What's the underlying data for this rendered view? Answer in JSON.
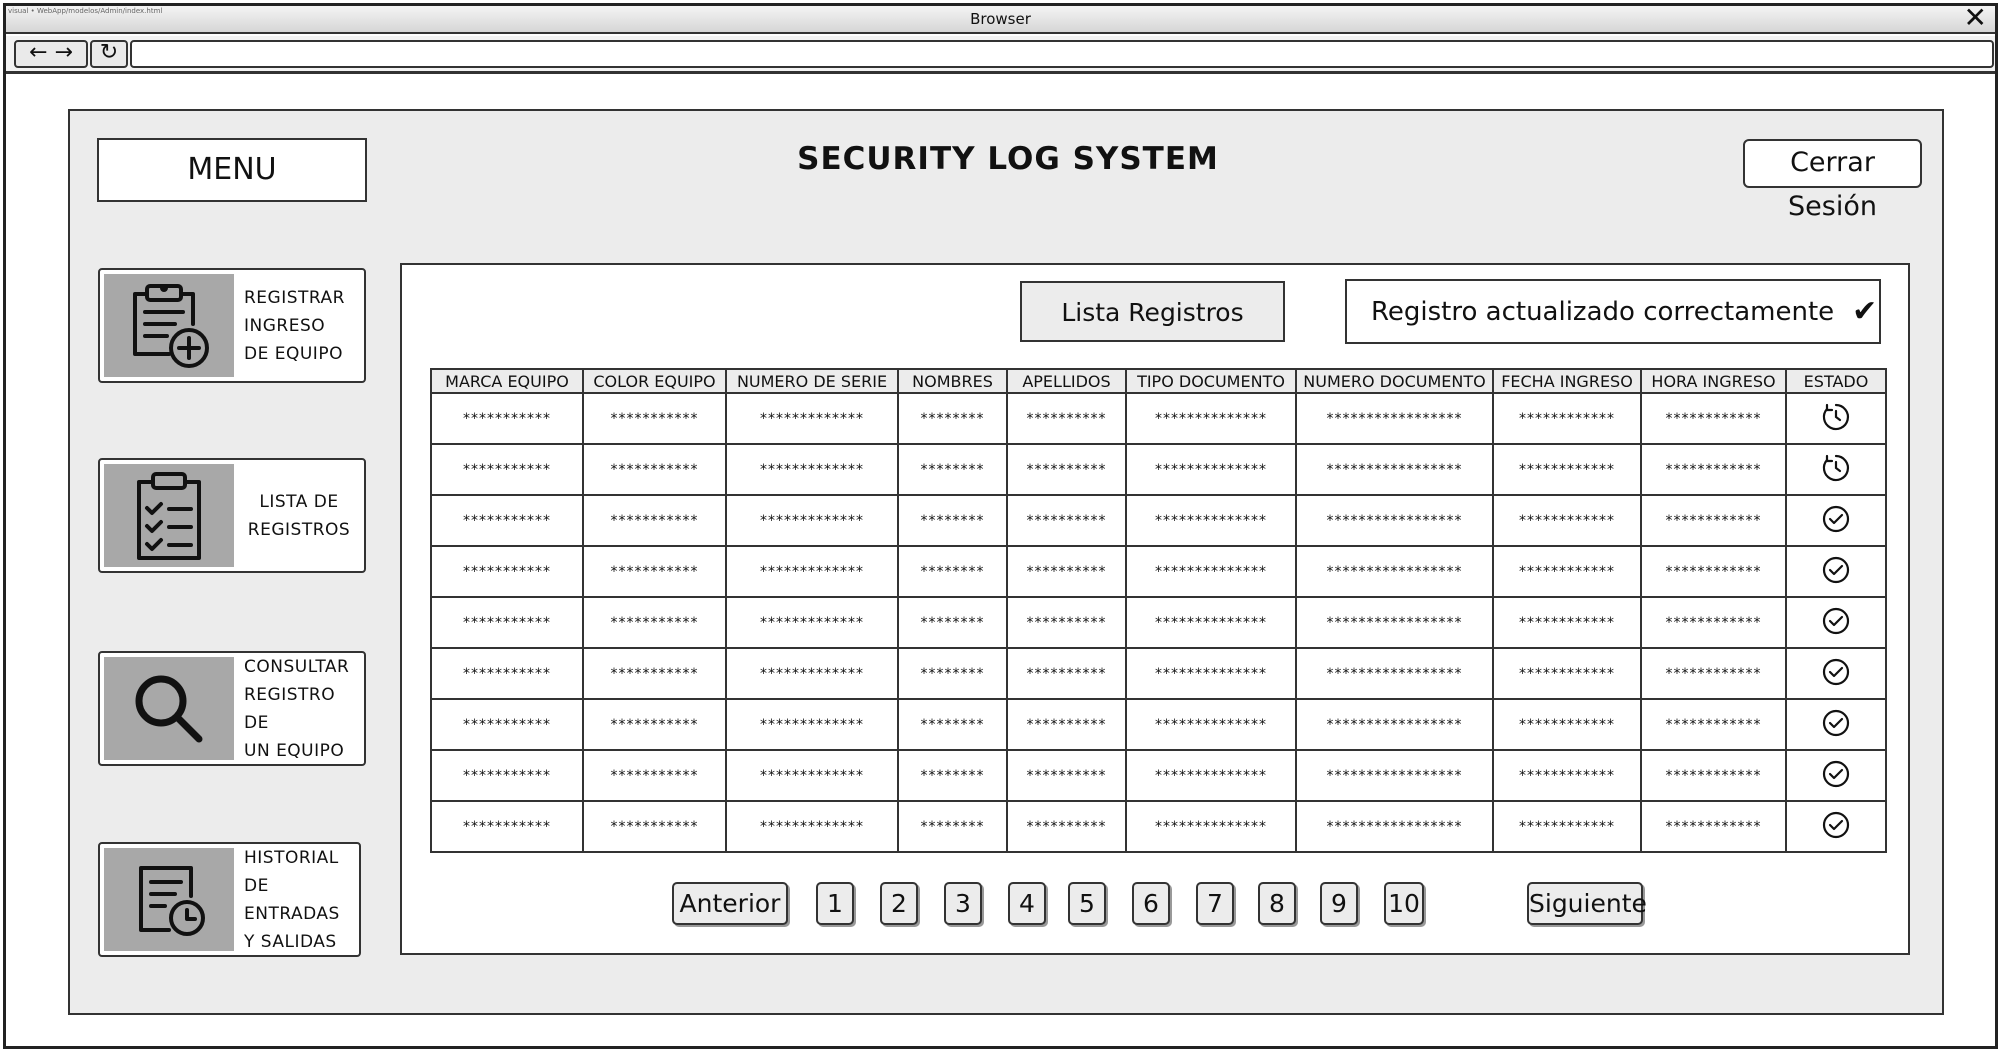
{
  "window": {
    "title": "Browser",
    "path": "visual • WebApp/modelos/Admin/index.html"
  },
  "app": {
    "menu_label": "MENU",
    "title": "SECURITY LOG SYSTEM",
    "logout_label": "Cerrar Sesión"
  },
  "sidebar": {
    "items": [
      {
        "icon": "clipboard-add-icon",
        "lines": [
          "REGISTRAR",
          "INGRESO",
          "DE EQUIPO"
        ]
      },
      {
        "icon": "checklist-icon",
        "lines": [
          "LISTA DE",
          "REGISTROS"
        ]
      },
      {
        "icon": "search-icon",
        "lines": [
          "CONSULTAR",
          "REGISTRO DE",
          "UN EQUIPO"
        ]
      },
      {
        "icon": "calendar-clock-icon",
        "lines": [
          "HISTORIAL",
          "DE ENTRADAS",
          "Y SALIDAS"
        ]
      }
    ]
  },
  "panel": {
    "tab_label": "Lista Registros",
    "message": "Registro actualizado correctamente",
    "message_icon": "checkmark-icon"
  },
  "table": {
    "columns": [
      "MARCA EQUIPO",
      "COLOR EQUIPO",
      "NUMERO DE SERIE",
      "NOMBRES",
      "APELLIDOS",
      "TIPO DOCUMENTO",
      "NUMERO DOCUMENTO",
      "FECHA INGRESO",
      "HORA INGRESO",
      "ESTADO"
    ],
    "rows": [
      {
        "cells": [
          "***********",
          "***********",
          "*************",
          "********",
          "**********",
          "**************",
          "*****************",
          "************",
          "************"
        ],
        "status": "pending"
      },
      {
        "cells": [
          "***********",
          "***********",
          "*************",
          "********",
          "**********",
          "**************",
          "*****************",
          "************",
          "************"
        ],
        "status": "pending"
      },
      {
        "cells": [
          "***********",
          "***********",
          "*************",
          "********",
          "**********",
          "**************",
          "*****************",
          "************",
          "************"
        ],
        "status": "done"
      },
      {
        "cells": [
          "***********",
          "***********",
          "*************",
          "********",
          "**********",
          "**************",
          "*****************",
          "************",
          "************"
        ],
        "status": "done"
      },
      {
        "cells": [
          "***********",
          "***********",
          "*************",
          "********",
          "**********",
          "**************",
          "*****************",
          "************",
          "************"
        ],
        "status": "done"
      },
      {
        "cells": [
          "***********",
          "***********",
          "*************",
          "********",
          "**********",
          "**************",
          "*****************",
          "************",
          "************"
        ],
        "status": "done"
      },
      {
        "cells": [
          "***********",
          "***********",
          "*************",
          "********",
          "**********",
          "**************",
          "*****************",
          "************",
          "************"
        ],
        "status": "done"
      },
      {
        "cells": [
          "***********",
          "***********",
          "*************",
          "********",
          "**********",
          "**************",
          "*****************",
          "************",
          "************"
        ],
        "status": "done"
      },
      {
        "cells": [
          "***********",
          "***********",
          "*************",
          "********",
          "**********",
          "**************",
          "*****************",
          "************",
          "************"
        ],
        "status": "done"
      }
    ]
  },
  "pagination": {
    "prev_label": "Anterior",
    "next_label": "Siguiente",
    "pages": [
      "1",
      "2",
      "3",
      "4",
      "5",
      "6",
      "7",
      "8",
      "9",
      "10"
    ]
  }
}
